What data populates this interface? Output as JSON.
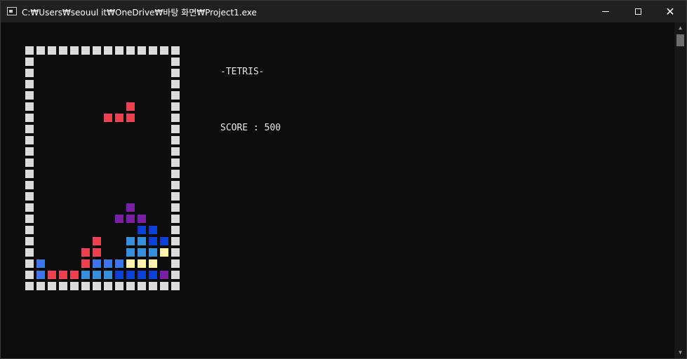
{
  "window": {
    "title": "C:₩Users₩seouul it₩OneDrive₩바탕 화면₩Project1.exe",
    "icon": "console-app-icon",
    "controls": [
      "minimize-icon",
      "maximize-icon",
      "close-icon"
    ]
  },
  "game": {
    "title": "-TETRIS-",
    "score_line": "SCORE : 500",
    "score": 500,
    "colors": {
      "wall": "#d9d9d9",
      "red": "#e8434f",
      "purple": "#7a1fa2",
      "blue": "#3b78e7",
      "darkblue": "#0b3fd6",
      "lightblue": "#3a8fd9",
      "yellow": "#fef3a6"
    },
    "board": {
      "columns": 14,
      "rows": 22,
      "legend": {
        "#": "wall",
        "R": "red",
        "P": "purple",
        "B": "blue",
        "D": "darkblue",
        "L": "lightblue",
        "Y": "yellow",
        ".": "empty"
      },
      "grid": [
        "##############",
        "#............#",
        "#............#",
        "#............#",
        "#............#",
        "#........R...#",
        "#......RRR...#",
        "#............#",
        "#............#",
        "#............#",
        "#............#",
        "#............#",
        "#............#",
        "#............#",
        "#........P...#",
        "#.......PPP..#",
        "#.........DD.#",
        "#.....R..LLDD#",
        "#....RR..LLLY#",
        "#B...RBBBYYY.#",
        "#BRRRLLLDDDDP#",
        "##############"
      ]
    }
  }
}
